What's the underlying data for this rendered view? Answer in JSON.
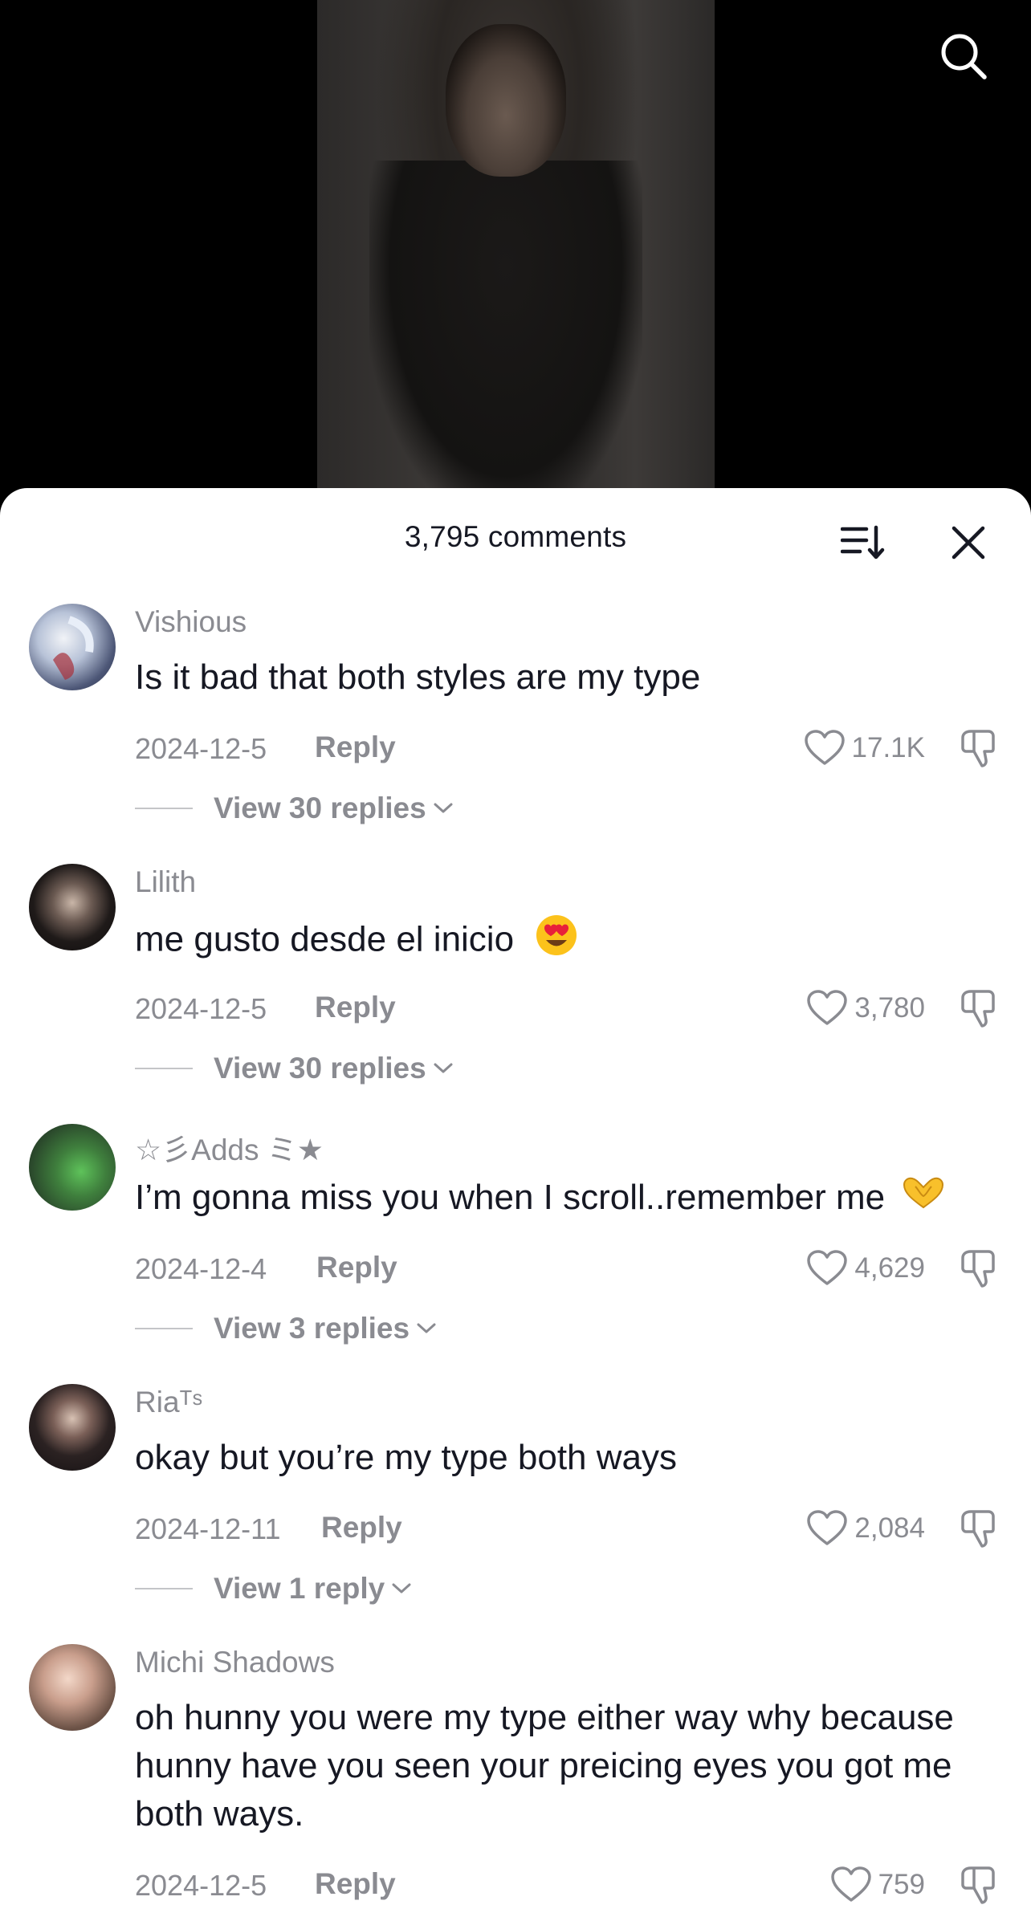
{
  "header": {
    "comment_count": "3,795 comments",
    "sort_icon": "sort-icon",
    "close_icon": "close-icon",
    "search_icon": "search-icon"
  },
  "comments": [
    {
      "username": "Vishious",
      "text": "Is it bad that both styles are my type",
      "date": "2024-12-5",
      "reply_label": "Reply",
      "likes": "17.1K",
      "view_replies": "View 30 replies"
    },
    {
      "username": "Lilith",
      "text": "me gusto desde el inicio",
      "emoji": "heart-eyes-emoji",
      "date": "2024-12-5",
      "reply_label": "Reply",
      "likes": "3,780",
      "view_replies": "View 30 replies"
    },
    {
      "username": "☆彡Adds ミ★",
      "text": "I’m gonna miss you when I scroll..remember me",
      "emoji": "heart-hands-emoji",
      "date": "2024-12-4",
      "reply_label": "Reply",
      "likes": "4,629",
      "view_replies": "View 3 replies"
    },
    {
      "username": "Riaᵀˢ",
      "text": "okay but you’re my type both ways",
      "date": "2024-12-11",
      "reply_label": "Reply",
      "likes": "2,084",
      "view_replies": "View 1 reply"
    },
    {
      "username": "Michi Shadows",
      "text": "oh hunny you were my type either way why because hunny have you seen your preicing eyes you got me both ways.",
      "date": "2024-12-5",
      "reply_label": "Reply",
      "likes": "759"
    }
  ],
  "colors": {
    "text_primary": "#161823",
    "text_secondary": "#8a8b91",
    "sheet_bg": "#ffffff",
    "video_bg": "#000000"
  }
}
